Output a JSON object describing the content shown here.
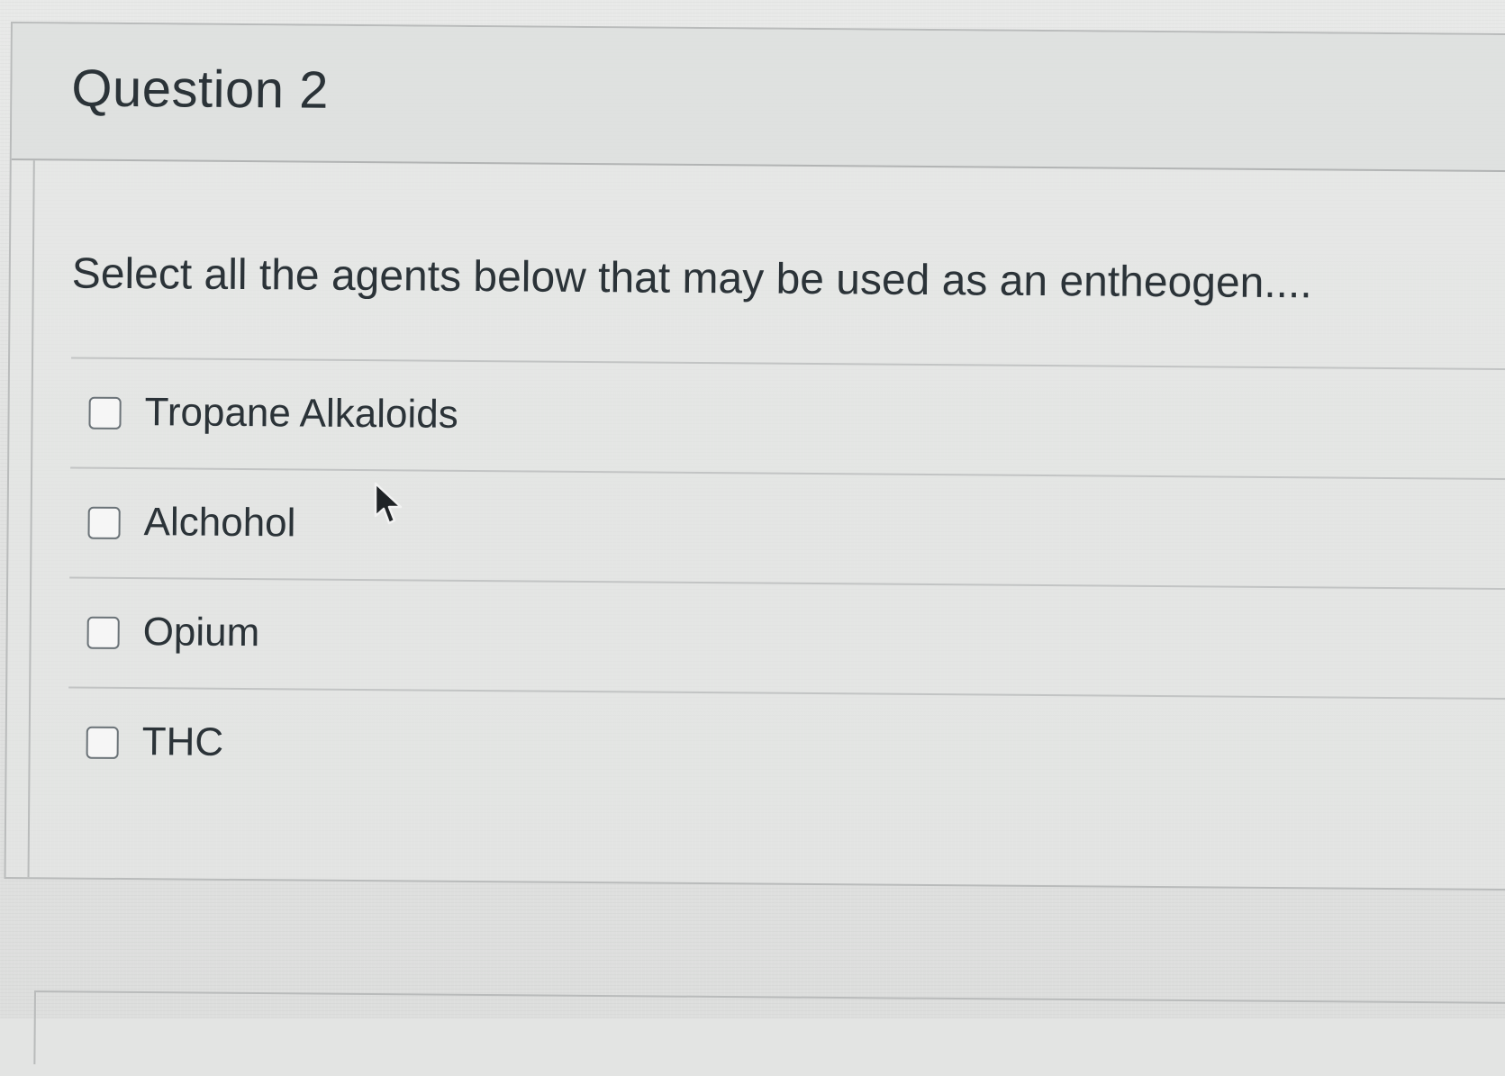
{
  "question": {
    "title": "Question 2",
    "prompt": "Select all the agents below that may be used as an entheogen....",
    "answers": [
      {
        "label": "Tropane Alkaloids",
        "checked": false
      },
      {
        "label": "Alchohol",
        "checked": false
      },
      {
        "label": "Opium",
        "checked": false
      },
      {
        "label": "THC",
        "checked": false
      }
    ]
  },
  "cursor": {
    "icon": "arrow-pointer-icon"
  }
}
